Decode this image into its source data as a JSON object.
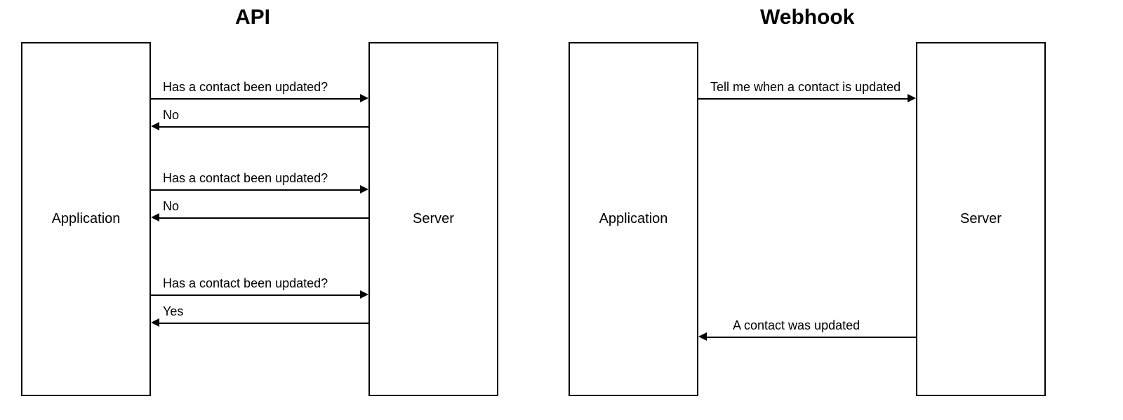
{
  "api": {
    "title": "API",
    "left_entity": "Application",
    "right_entity": "Server",
    "messages": [
      {
        "direction": "right",
        "text": "Has a contact been updated?"
      },
      {
        "direction": "left",
        "text": "No"
      },
      {
        "direction": "right",
        "text": "Has a contact been updated?"
      },
      {
        "direction": "left",
        "text": "No"
      },
      {
        "direction": "right",
        "text": "Has a contact been updated?"
      },
      {
        "direction": "left",
        "text": "Yes"
      }
    ]
  },
  "webhook": {
    "title": "Webhook",
    "left_entity": "Application",
    "right_entity": "Server",
    "messages": [
      {
        "direction": "right",
        "text": "Tell me when a contact is updated"
      },
      {
        "direction": "left",
        "text": "A contact was updated"
      }
    ]
  }
}
